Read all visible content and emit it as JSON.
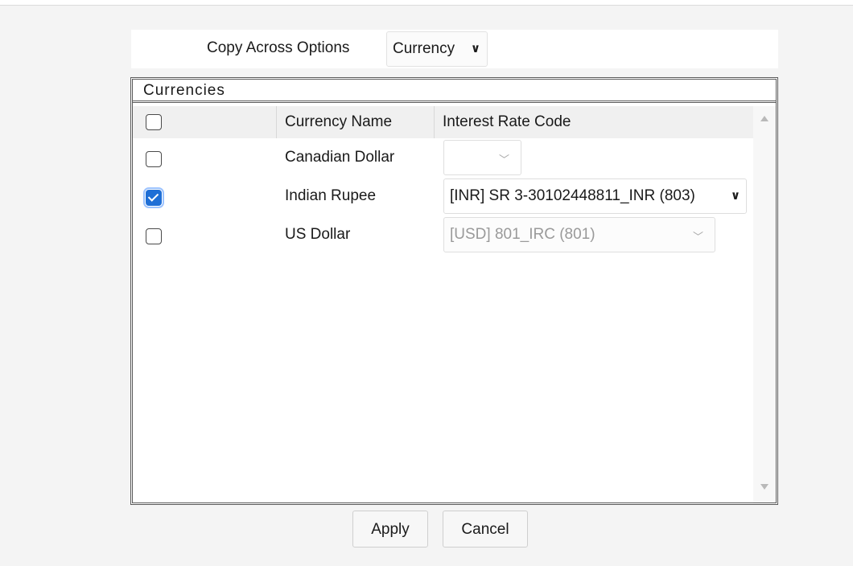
{
  "options": {
    "label": "Copy Across Options",
    "selected": "Currency",
    "chevron": "⌄"
  },
  "panel": {
    "title": "Currencies",
    "columns": {
      "name": "Currency Name",
      "rate": "Interest Rate Code"
    },
    "rows": [
      {
        "name": "Canadian Dollar",
        "checked": false,
        "rate": "",
        "rate_disabled": false
      },
      {
        "name": "Indian Rupee",
        "checked": true,
        "rate": "[INR] SR 3-30102448811_INR (803)",
        "rate_disabled": false
      },
      {
        "name": "US Dollar",
        "checked": false,
        "rate": "[USD] 801_IRC (801)",
        "rate_disabled": true
      }
    ]
  },
  "buttons": {
    "apply": "Apply",
    "cancel": "Cancel"
  },
  "colors": {
    "accent": "#1f6fd6",
    "page_bg": "#f4f4f4"
  }
}
